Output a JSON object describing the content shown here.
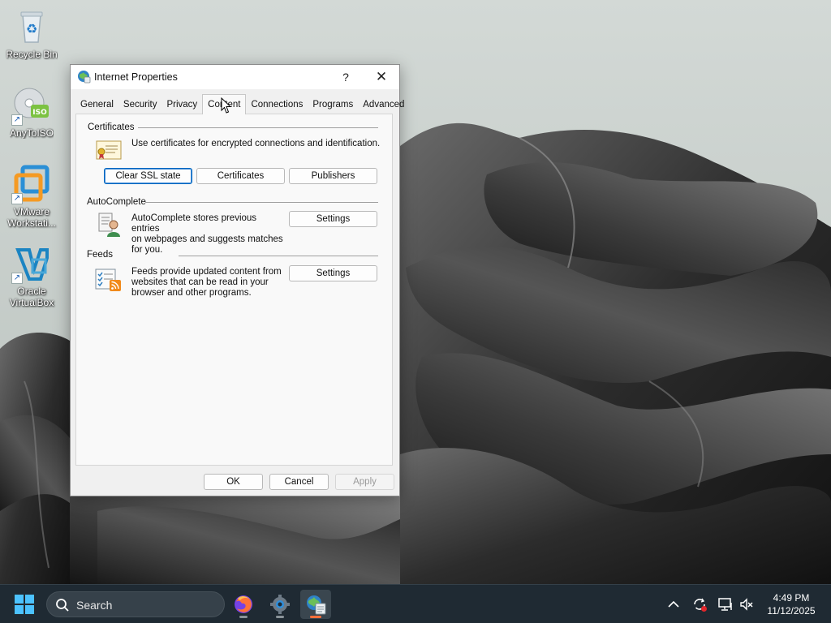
{
  "desktop": {
    "icons": [
      {
        "label": "Recycle Bin"
      },
      {
        "label": "AnyToISO",
        "badge": "ISO"
      },
      {
        "label": "VMware Workstati..."
      },
      {
        "label": "Oracle VirtualBox"
      }
    ]
  },
  "dialog": {
    "title": "Internet Properties",
    "help_glyph": "?",
    "close_glyph": "✕",
    "tabs": [
      "General",
      "Security",
      "Privacy",
      "Content",
      "Connections",
      "Programs",
      "Advanced"
    ],
    "active_tab": "Content",
    "certificates": {
      "title": "Certificates",
      "description": "Use certificates for encrypted connections and identification.",
      "buttons": {
        "clear_ssl": "Clear SSL state",
        "certificates": "Certificates",
        "publishers": "Publishers"
      }
    },
    "autocomplete": {
      "title": "AutoComplete",
      "description_lines": [
        "AutoComplete stores previous entries",
        "on webpages and suggests matches",
        "for you."
      ],
      "settings_button": "Settings"
    },
    "feeds": {
      "title": "Feeds",
      "description_lines": [
        "Feeds provide updated content from",
        "websites that can be read in your",
        "browser and other programs."
      ],
      "settings_button": "Settings"
    },
    "footer": {
      "ok": "OK",
      "cancel": "Cancel",
      "apply": "Apply"
    }
  },
  "taskbar": {
    "search_label": "Search",
    "apps": [
      "firefox-icon",
      "settings-gear-icon",
      "internet-properties-icon"
    ],
    "clock": {
      "time": "4:49 PM",
      "date": "11/12/2025"
    }
  },
  "colors": {
    "accent": "#0067c0",
    "taskbar_bg": "#1f2a33",
    "active_indicator": "#ff6e3a"
  }
}
